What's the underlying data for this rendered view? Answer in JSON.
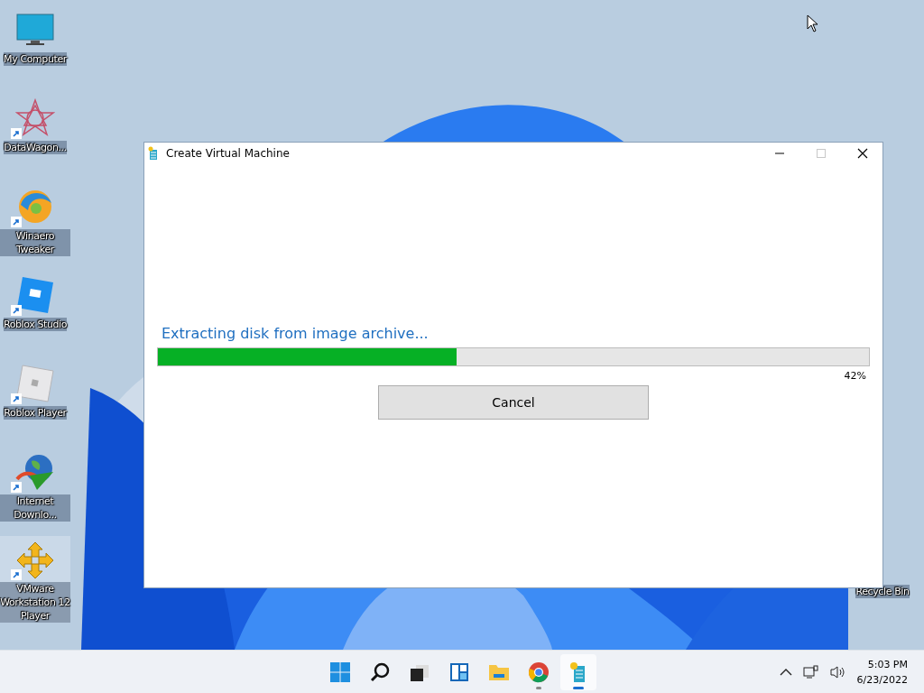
{
  "desktop_icons": [
    {
      "label": "My Computer",
      "shortcut": false,
      "selected": false
    },
    {
      "label": "DataWagon...",
      "shortcut": true,
      "selected": false
    },
    {
      "label": "Winaero Tweaker",
      "shortcut": true,
      "selected": false
    },
    {
      "label": "Roblox Studio",
      "shortcut": true,
      "selected": false
    },
    {
      "label": "Roblox Player",
      "shortcut": true,
      "selected": false
    },
    {
      "label": "Internet Downlo...",
      "shortcut": true,
      "selected": false
    },
    {
      "label": "VMware Workstation 12 Player",
      "shortcut": true,
      "selected": true
    }
  ],
  "recycle_bin": {
    "label": "Recycle Bin"
  },
  "window": {
    "title": "Create Virtual Machine",
    "maximize_disabled": true,
    "status": "Extracting disk from image archive...",
    "progress": {
      "level": 0.42,
      "percent": "42%"
    },
    "cancel_button": "Cancel"
  },
  "taskbar": {
    "apps": [
      {
        "running": false,
        "active": false
      },
      {
        "running": false,
        "active": false
      },
      {
        "running": false,
        "active": false
      },
      {
        "running": false,
        "active": false
      },
      {
        "running": false,
        "active": false
      },
      {
        "running": true,
        "active": false
      },
      {
        "running": true,
        "active": true
      }
    ],
    "time": "5:03 PM",
    "date": "6/23/2022"
  }
}
